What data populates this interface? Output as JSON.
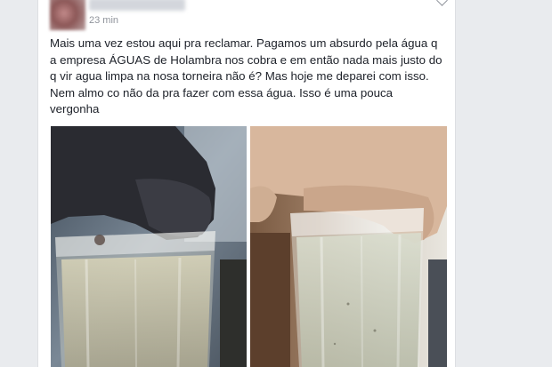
{
  "post": {
    "timestamp": "23 min",
    "text": "Mais uma vez estou aqui pra reclamar. Pagamos um absurdo pela água q\na empresa ÁGUAS de Holambra nos cobra e em então nada mais justo do\nq vir agua limpa na nosa torneira não é? Mas hoje me deparei com isso.\nNem almo co não da pra fazer com essa água. Isso é uma pouca\nvergonha"
  },
  "icons": {
    "timestamp": "clock-icon",
    "menu": "chevron-down-icon"
  },
  "photos": [
    {
      "subject": "glass-of-cloudy-water-held-by-hand"
    },
    {
      "subject": "glass-of-cloudy-water-held-by-hand"
    }
  ],
  "colors": {
    "page_background": "#e9ebee",
    "card_background": "#ffffff",
    "text": "#1d2129",
    "meta_text": "#90949c"
  }
}
